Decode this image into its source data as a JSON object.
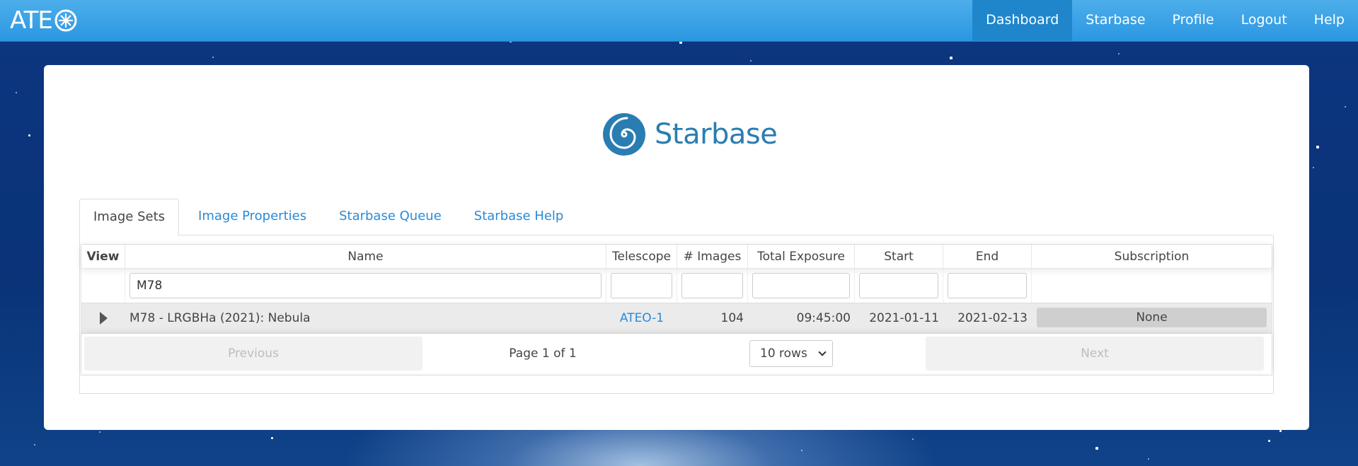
{
  "brand": {
    "text": "ATE"
  },
  "nav": [
    {
      "label": "Dashboard",
      "active": true
    },
    {
      "label": "Starbase"
    },
    {
      "label": "Profile"
    },
    {
      "label": "Logout"
    },
    {
      "label": "Help"
    }
  ],
  "logo": {
    "title": "Starbase"
  },
  "tabs": [
    {
      "label": "Image Sets",
      "active": true
    },
    {
      "label": "Image Properties"
    },
    {
      "label": "Starbase Queue"
    },
    {
      "label": "Starbase Help"
    }
  ],
  "table": {
    "headers": [
      "View",
      "Name",
      "Telescope",
      "# Images",
      "Total Exposure",
      "Start",
      "End",
      "Subscription"
    ],
    "filters": {
      "name": "M78",
      "telescope": "",
      "images": "",
      "exposure": "",
      "start": "",
      "end": ""
    },
    "rows": [
      {
        "name": "M78 - LRGBHa (2021): Nebula",
        "telescope": "ATEO-1",
        "images": "104",
        "exposure": "09:45:00",
        "start": "2021-01-11",
        "end": "2021-02-13",
        "subscription": "None"
      }
    ]
  },
  "pager": {
    "previous": "Previous",
    "page_info": "Page 1 of 1",
    "rows_select": "10 rows",
    "next": "Next"
  },
  "colors": {
    "nav_bg": "#2b97e2",
    "link": "#2b8ad6",
    "logo": "#2a7db2"
  }
}
